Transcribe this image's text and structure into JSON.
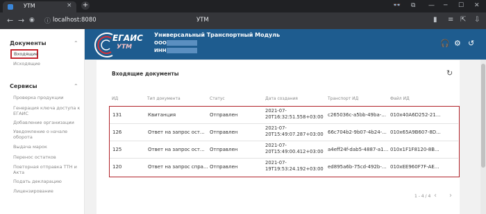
{
  "browser": {
    "tab_title": "УТМ",
    "tab_close": "×",
    "new_tab": "+",
    "url": "localhost:8080",
    "page_title": "УТМ"
  },
  "sidebar": {
    "sections": [
      {
        "title": "Документы",
        "items": [
          "Входящие",
          "Исходящие"
        ]
      },
      {
        "title": "Сервисы",
        "items": [
          "Проверка продукции",
          "Генерация ключа доступа к ЕГАИС",
          "Добавление организации",
          "Уведомление о начале оборота",
          "Выдача марок",
          "Перенос остатков",
          "Повторная отправка ТТН и Акта",
          "Подать декларацию",
          "Лицензирование"
        ]
      }
    ],
    "active_item": "Входящие"
  },
  "header": {
    "logo_main": "ЕГАИС",
    "logo_sub": "УТМ",
    "title": "Универсальный Транспортный Модуль",
    "org_label": "ООО",
    "inn_label": "ИНН:",
    "colors": {
      "background": "#1e5c8f",
      "accent": "#c5262e"
    },
    "icons": [
      "headset-icon",
      "gear-icon",
      "history-icon"
    ]
  },
  "card": {
    "title": "Входящие документы",
    "columns": [
      "ИД",
      "Тип документа",
      "Статус",
      "Дата создания",
      "Транспорт ИД",
      "Файл ИД"
    ],
    "rows": [
      {
        "id": "131",
        "type": "Квитанция",
        "status": "Отправлен",
        "date": "2021-07-20T16:32:51.558+03:00",
        "transport": "c265036c-a5bb-49ba-...",
        "file": "010x40A6D252-21..."
      },
      {
        "id": "126",
        "type": "Ответ на запрос ост...",
        "status": "Отправлен",
        "date": "2021-07-20T15:49:07.287+03:00",
        "transport": "66c704b2-9b07-4b24-...",
        "file": "010x65A9B607-8D..."
      },
      {
        "id": "125",
        "type": "Ответ на запрос ост...",
        "status": "Отправлен",
        "date": "2021-07-20T15:49:00.412+03:00",
        "transport": "a4eff24f-dab5-4887-a1...",
        "file": "010x1F1F8120-8B..."
      },
      {
        "id": "120",
        "type": "Ответ на запрос спра...",
        "status": "Отправлен",
        "date": "2021-07-19T19:53:24.192+03:00",
        "transport": "ed895a6b-75cd-492b-...",
        "file": "010xEE960F7F-AE..."
      }
    ],
    "pagination": "1 - 4 / 4"
  }
}
